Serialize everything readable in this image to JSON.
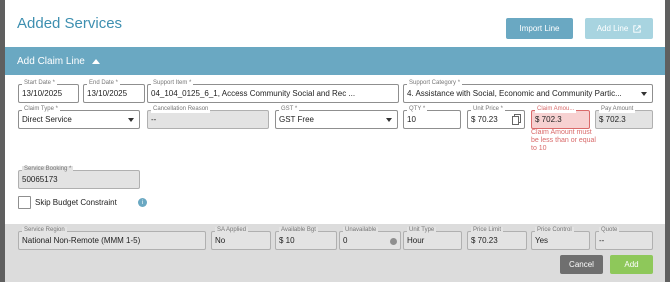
{
  "header": {
    "title": "Added Services",
    "import_line": "Import Line",
    "add_line": "Add Line"
  },
  "section": {
    "title": "Add Claim Line"
  },
  "row1": {
    "start_date": {
      "label": "Start Date *",
      "value": "13/10/2025"
    },
    "end_date": {
      "label": "End Date *",
      "value": "13/10/2025"
    },
    "support_item": {
      "label": "Support Item *",
      "value": "04_104_0125_6_1, Access Community Social and Rec ..."
    },
    "support_category": {
      "label": "Support Category *",
      "value": "4. Assistance with Social, Economic and Community Partic..."
    }
  },
  "row2": {
    "claim_type": {
      "label": "Claim Type *",
      "value": "Direct Service"
    },
    "cancellation_reason": {
      "label": "Cancellation Reason",
      "value": "--"
    },
    "gst": {
      "label": "GST *",
      "value": "GST Free"
    },
    "qty": {
      "label": "QTY *",
      "value": "10"
    },
    "unit_price": {
      "label": "Unit Price *",
      "value": "$ 70.23"
    },
    "claim_amount": {
      "label": "Claim Amou...",
      "value": "$ 702.3",
      "error": "Claim Amount must be less than or equal to 10"
    },
    "pay_amount": {
      "label": "Pay Amount",
      "value": "$ 702.3"
    }
  },
  "row3": {
    "service_booking": {
      "label": "Service Booking *",
      "value": "50065173"
    }
  },
  "skip_budget": {
    "label": "Skip Budget Constraint"
  },
  "bottom": {
    "service_region": {
      "label": "Service Region",
      "value": "National Non-Remote (MMM 1-5)"
    },
    "sa_applied": {
      "label": "SA Applied",
      "value": "No"
    },
    "available_bgt": {
      "label": "Available Bgt",
      "value": "$ 10"
    },
    "unavailable": {
      "label": "Unavailable",
      "value": "0"
    },
    "unit_type": {
      "label": "Unit Type",
      "value": "Hour"
    },
    "price_limit": {
      "label": "Price Limit",
      "value": "$ 70.23"
    },
    "price_control": {
      "label": "Price Control",
      "value": "Yes"
    },
    "quote": {
      "label": "Quote",
      "value": "--"
    }
  },
  "footer": {
    "cancel": "Cancel",
    "add": "Add"
  },
  "colors": {
    "accent": "#6aa8c2",
    "title": "#3d8fb0",
    "error": "#d96a6a",
    "add_green": "#8ec85a"
  },
  "icons": [
    "external-link-icon",
    "chevron-up-icon",
    "chevron-down-icon",
    "copy-icon",
    "info-icon"
  ]
}
